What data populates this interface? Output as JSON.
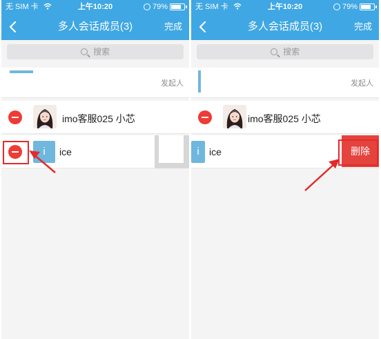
{
  "colors": {
    "nav_bar": "#3fa7e4",
    "minus": "#ee3b36",
    "delete": "#e4433e",
    "annotation": "#e42a2a",
    "letter_avatar": "#6fb7dd"
  },
  "screens": [
    {
      "status": {
        "carrier": "无 SIM 卡",
        "time": "上午10:20",
        "battery": "79%"
      },
      "nav": {
        "back_icon": "chevron-left-icon",
        "title": "多人会话成员(3)",
        "done": "完成"
      },
      "search": {
        "placeholder": "搜索",
        "icon": "search-icon"
      },
      "creator_label": "发起人",
      "members": [
        {
          "name": "imo客服025 小芯",
          "avatar": "photo"
        },
        {
          "name": "ice",
          "avatar_letter": "i"
        }
      ]
    },
    {
      "status": {
        "carrier": "无 SIM 卡",
        "time": "上午10:20",
        "battery": "79%"
      },
      "nav": {
        "back_icon": "chevron-left-icon",
        "title": "多人会话成员(3)",
        "done": "完成"
      },
      "search": {
        "placeholder": "搜索",
        "icon": "search-icon"
      },
      "creator_label": "发起人",
      "members": [
        {
          "name": "imo客服025 小芯",
          "avatar": "photo"
        },
        {
          "name": "ice",
          "avatar_letter": "i"
        }
      ],
      "delete_label": "删除"
    }
  ]
}
